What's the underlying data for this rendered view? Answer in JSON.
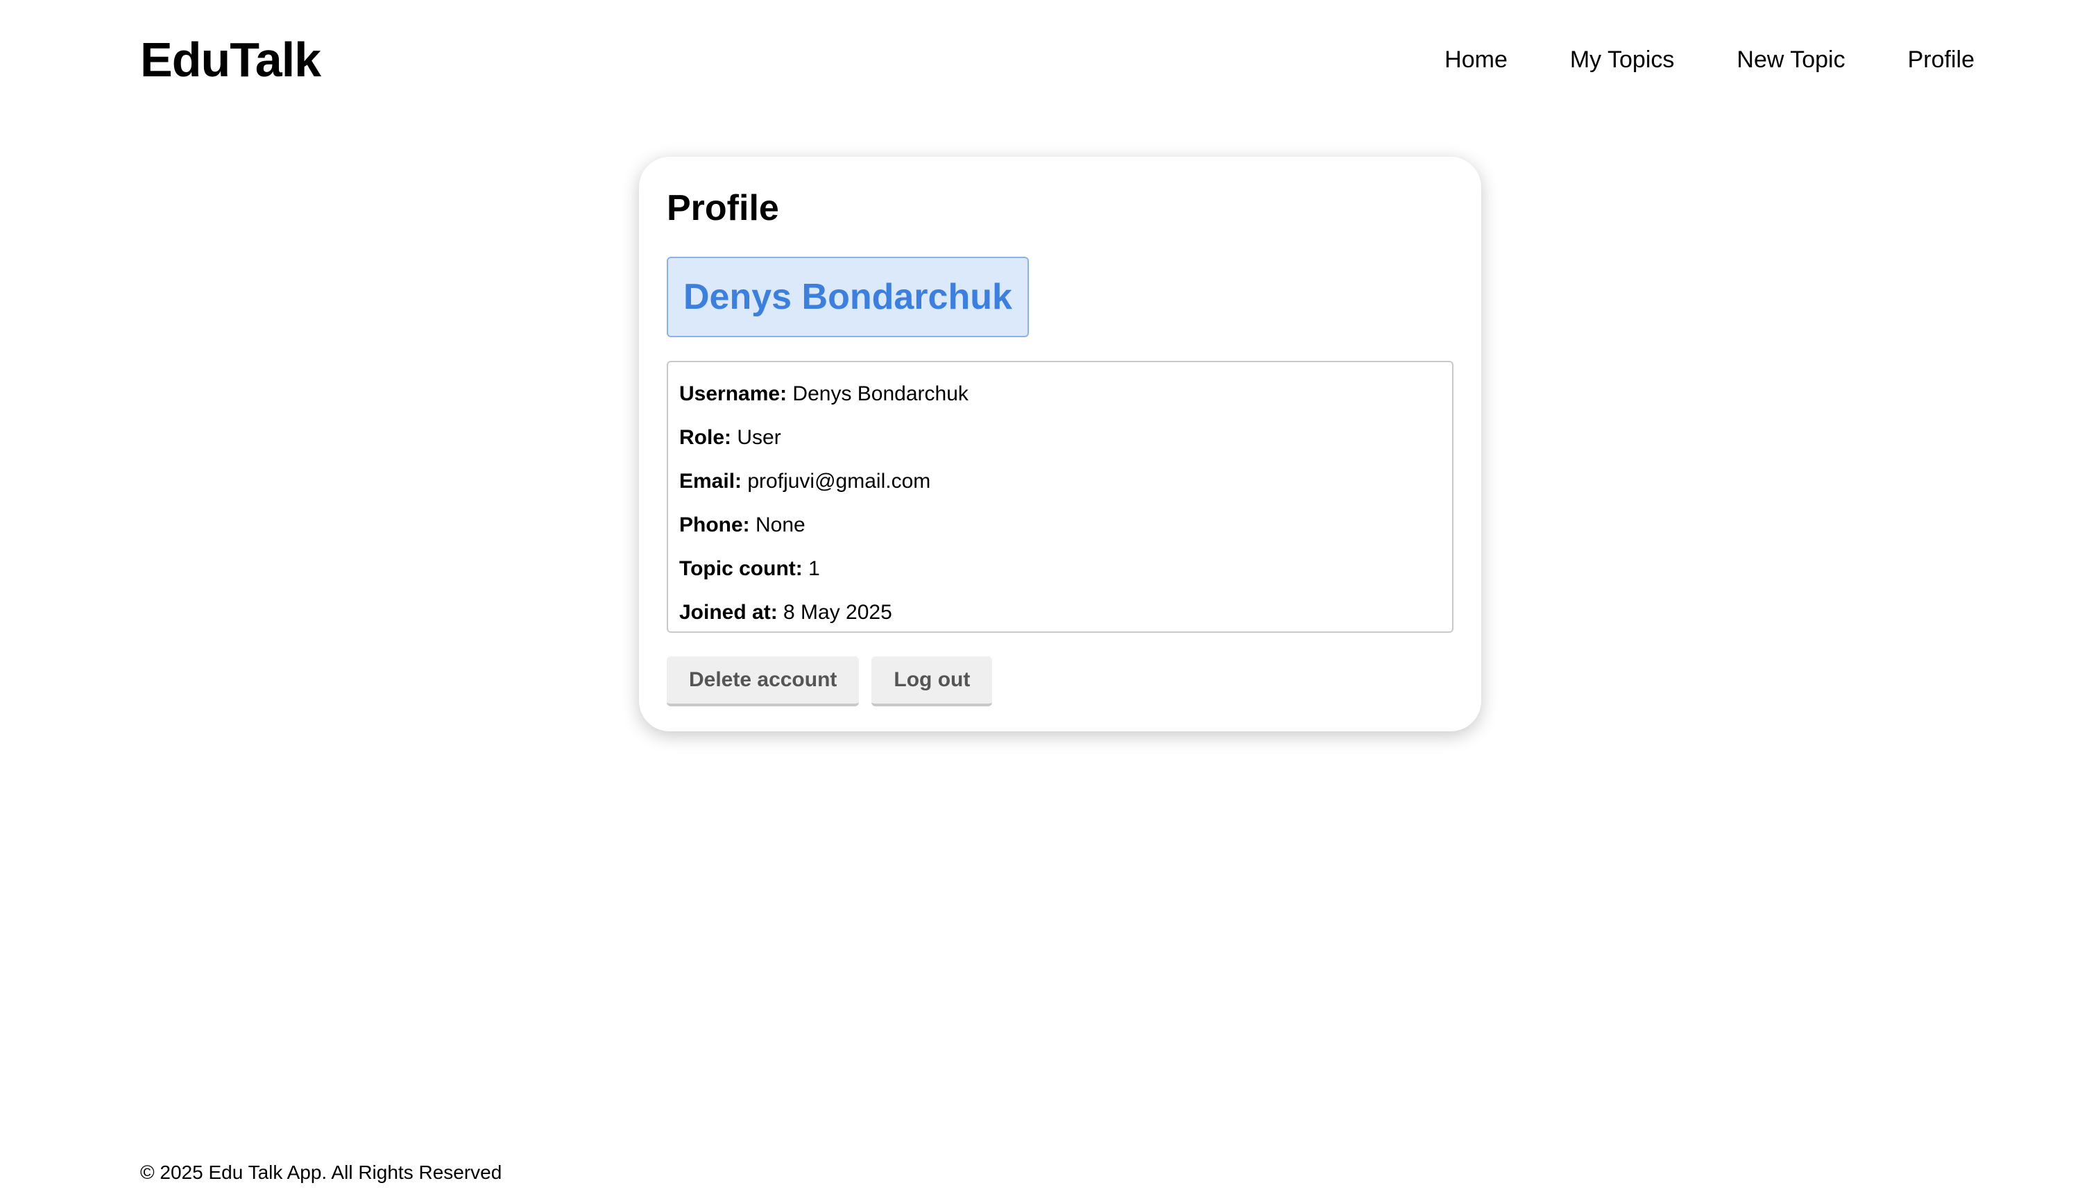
{
  "header": {
    "logo": "EduTalk",
    "nav": [
      {
        "label": "Home"
      },
      {
        "label": "My Topics"
      },
      {
        "label": "New Topic"
      },
      {
        "label": "Profile"
      }
    ]
  },
  "profile": {
    "title": "Profile",
    "display_name": "Denys Bondarchuk",
    "fields": [
      {
        "key": "Username:",
        "value": "Denys Bondarchuk"
      },
      {
        "key": "Role:",
        "value": "User"
      },
      {
        "key": "Email:",
        "value": "profjuvi@gmail.com"
      },
      {
        "key": "Phone:",
        "value": "None"
      },
      {
        "key": "Topic count:",
        "value": "1"
      },
      {
        "key": "Joined at:",
        "value": "8 May 2025"
      }
    ],
    "buttons": {
      "delete_label": "Delete account",
      "logout_label": "Log out"
    }
  },
  "footer": {
    "text": "© 2025 Edu Talk App. All Rights Reserved"
  },
  "colors": {
    "accent": "#3b7fe0",
    "banner_bg": "#dce9fb",
    "banner_border": "#8ab2ec"
  }
}
